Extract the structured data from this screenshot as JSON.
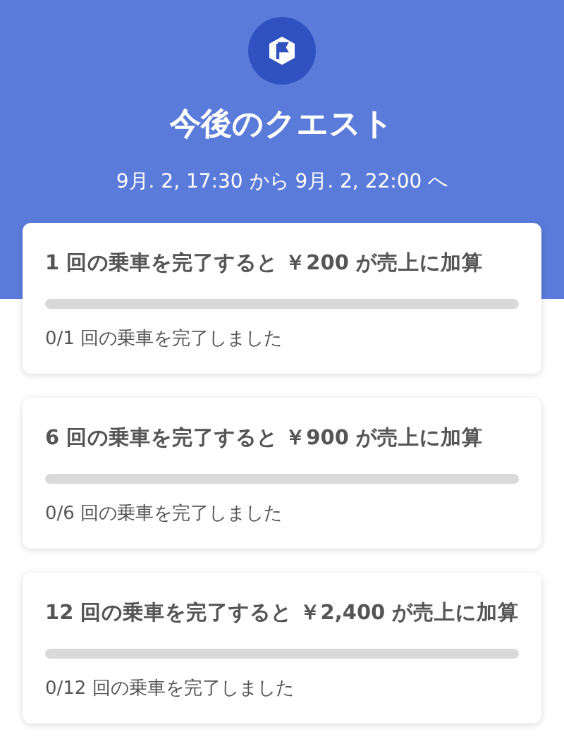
{
  "header": {
    "title": "今後のクエスト",
    "period": "9月. 2, 17:30 から 9月. 2, 22:00 へ"
  },
  "quests": [
    {
      "goal": "1 回の乗車を完了すると ￥200 が売上に加算",
      "level": 0,
      "progress": "0/1 回の乗車を完了しました"
    },
    {
      "goal": "6 回の乗車を完了すると ￥900 が売上に加算",
      "level": 0,
      "progress": "0/6 回の乗車を完了しました"
    },
    {
      "goal": "12 回の乗車を完了すると ￥2,400 が売上に加算",
      "level": 0,
      "progress": "0/12 回の乗車を完了しました"
    }
  ]
}
